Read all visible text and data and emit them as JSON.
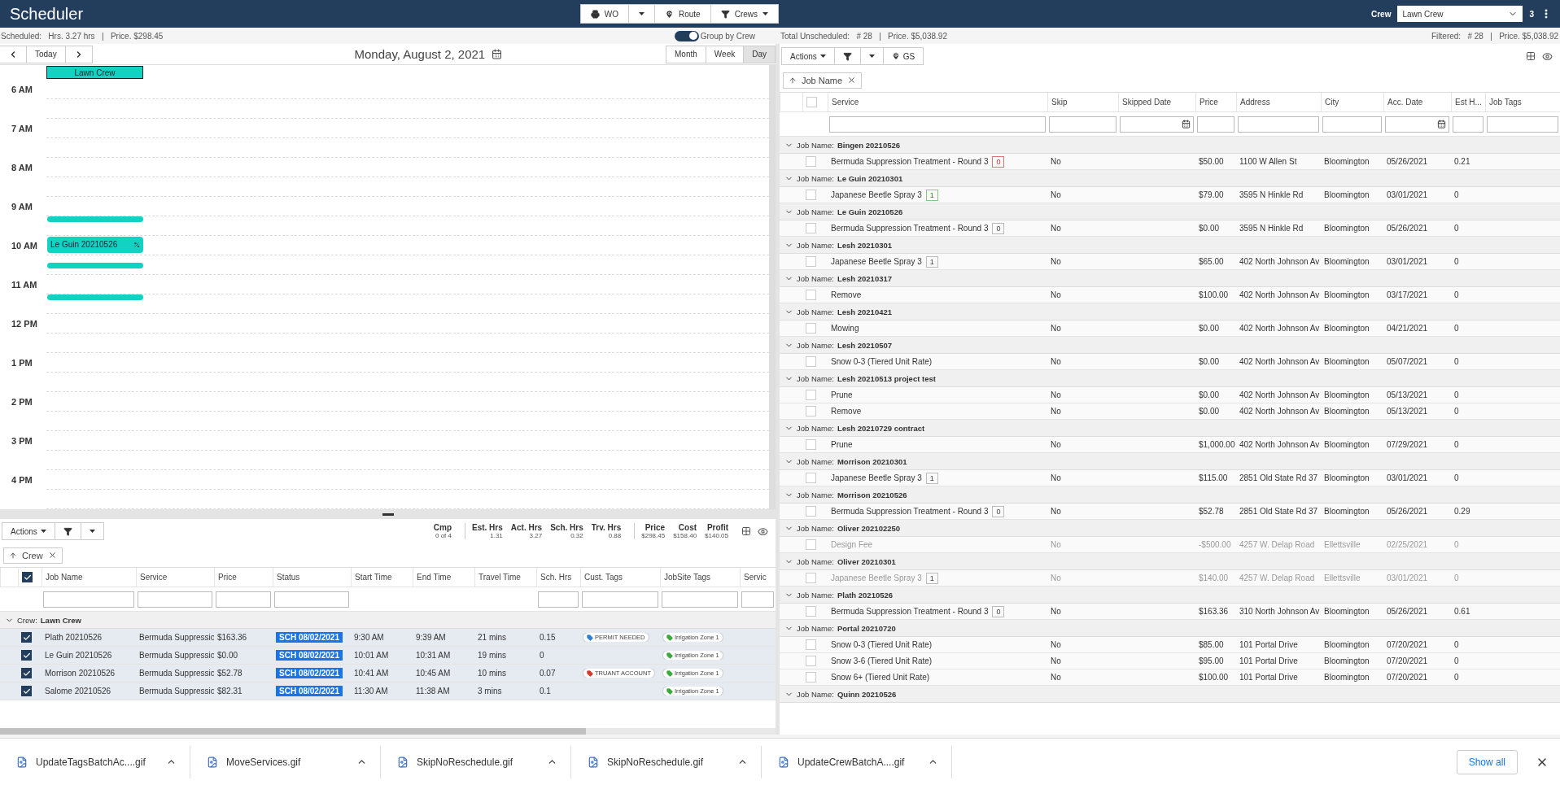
{
  "app": {
    "title": "Scheduler"
  },
  "toolbar": {
    "buttons": [
      {
        "kind": "print",
        "label": "WO"
      },
      {
        "kind": "menu"
      },
      {
        "kind": "route",
        "label": "Route"
      },
      {
        "kind": "crews",
        "label": "Crews"
      }
    ]
  },
  "crew_picker": {
    "label": "Crew",
    "value": "Lawn Crew",
    "count": "3"
  },
  "scheduled_summary": {
    "parts": [
      "Scheduled:",
      "Hrs. 3.27 hrs",
      "|",
      "Price. $298.45"
    ]
  },
  "group_toggle": {
    "label": "Group by Crew",
    "on": true
  },
  "unscheduled_summary": {
    "parts": [
      "Total Unscheduled:",
      "# 28",
      "|",
      "Price. $5,038.92"
    ]
  },
  "filtered_summary": {
    "parts": [
      "Filtered:",
      "# 28",
      "|",
      "Price. $5,038.92"
    ]
  },
  "calendar": {
    "today": "Today",
    "date": "Monday, August 2, 2021",
    "views": [
      {
        "label": "Month",
        "selected": false
      },
      {
        "label": "Week",
        "selected": false
      },
      {
        "label": "Day",
        "selected": true
      }
    ],
    "resource": "Lawn Crew",
    "hours": [
      "6 AM",
      "7 AM",
      "8 AM",
      "9 AM",
      "10 AM",
      "11 AM",
      "12 PM",
      "1 PM",
      "2 PM",
      "3 PM",
      "4 PM"
    ],
    "events": [
      {
        "kind": "bar"
      },
      {
        "kind": "titled",
        "title": "Le Guin 20210526"
      },
      {
        "kind": "bar"
      },
      {
        "kind": "bar"
      }
    ]
  },
  "crew_grid": {
    "actions": "Actions",
    "stat_groups": [
      {
        "items": [
          {
            "label": "Cmp",
            "value": "0 of 4"
          }
        ]
      },
      {
        "items": [
          {
            "label": "Est. Hrs",
            "value": "1.31"
          },
          {
            "label": "Act. Hrs",
            "value": "3.27"
          },
          {
            "label": "Sch. Hrs",
            "value": "0.32"
          },
          {
            "label": "Trv. Hrs",
            "value": "0.88"
          }
        ]
      },
      {
        "items": [
          {
            "label": "Price",
            "value": "$298.45"
          },
          {
            "label": "Cost",
            "value": "$158.40"
          },
          {
            "label": "Profit",
            "value": "$140.05"
          }
        ]
      }
    ],
    "group_chip": "Crew",
    "select_all": true,
    "columns": [
      {
        "label": "Job Name",
        "filter": true
      },
      {
        "label": "Service",
        "filter": true
      },
      {
        "label": "Price",
        "filter": true
      },
      {
        "label": "Status",
        "filter": true
      },
      {
        "label": "Start Time",
        "filter": false
      },
      {
        "label": "End Time",
        "filter": false
      },
      {
        "label": "Travel Time",
        "filter": false
      },
      {
        "label": "Sch. Hrs",
        "filter": true
      },
      {
        "label": "Cust. Tags",
        "filter": true
      },
      {
        "label": "JobSite Tags",
        "filter": true
      },
      {
        "label": "Servic",
        "filter": true
      }
    ],
    "group": {
      "label": "Crew:",
      "name": "Lawn Crew",
      "expanded": true
    },
    "rows": [
      {
        "checked": true,
        "job": "Plath 20210526",
        "service": "Bermuda Suppressio",
        "price": "$163.36",
        "status": "SCH 08/02/2021",
        "start": "9:30 AM",
        "end": "9:39 AM",
        "travel": "21 mins",
        "sch_hrs": "0.15",
        "cust_tags": [
          {
            "label": "PERMIT NEEDED",
            "color": "#2f80d1"
          }
        ],
        "site_tags": [
          {
            "label": "Irrigation Zone 1",
            "color": "#3bab3b"
          }
        ]
      },
      {
        "checked": true,
        "job": "Le Guin 20210526",
        "service": "Bermuda Suppressio",
        "price": "$0.00",
        "status": "SCH 08/02/2021",
        "start": "10:01 AM",
        "end": "10:31 AM",
        "travel": "19 mins",
        "sch_hrs": "0",
        "site_tags": [
          {
            "label": "Irrigation Zone 1",
            "color": "#3bab3b"
          }
        ]
      },
      {
        "checked": true,
        "job": "Morrison 20210526",
        "service": "Bermuda Suppressio",
        "price": "$52.78",
        "status": "SCH 08/02/2021",
        "start": "10:41 AM",
        "end": "10:45 AM",
        "travel": "10 mins",
        "sch_hrs": "0.07",
        "cust_tags": [
          {
            "label": "TRUANT ACCOUNT",
            "color": "#d23a2e"
          }
        ],
        "site_tags": [
          {
            "label": "Irrigation Zone 1",
            "color": "#3bab3b"
          }
        ]
      },
      {
        "checked": true,
        "job": "Salome 20210526",
        "service": "Bermuda Suppressio",
        "price": "$82.31",
        "status": "SCH 08/02/2021",
        "start": "11:30 AM",
        "end": "11:38 AM",
        "travel": "3 mins",
        "sch_hrs": "0.1",
        "site_tags": [
          {
            "label": "Irrigation Zone 1",
            "color": "#3bab3b"
          }
        ]
      }
    ]
  },
  "unscheduled_grid": {
    "actions": "Actions",
    "locate": "GS",
    "group_chip": "Job Name",
    "select_all": false,
    "columns": [
      {
        "label": "Service",
        "kind": "text"
      },
      {
        "label": "Skip",
        "kind": "text"
      },
      {
        "label": "Skipped Date",
        "kind": "date"
      },
      {
        "label": "Price",
        "kind": "text"
      },
      {
        "label": "Address",
        "kind": "text"
      },
      {
        "label": "City",
        "kind": "text"
      },
      {
        "label": "Acc. Date",
        "kind": "date"
      },
      {
        "label": "Est H...",
        "kind": "text"
      },
      {
        "label": "Job Tags",
        "kind": "text"
      }
    ],
    "groups": [
      {
        "label": "Job Name:",
        "name": "Bingen 20210526",
        "expanded": true,
        "rows": [
          {
            "checked": false,
            "dimmed": false,
            "service": "Bermuda Suppression Treatment - Round 3",
            "badge": {
              "value": "0",
              "kind": "alert"
            },
            "skip": "No",
            "price": "$50.00",
            "address": "1100 W Allen St",
            "city": "Bloomington",
            "acc_date": "05/26/2021",
            "est": "0.21"
          }
        ]
      },
      {
        "label": "Job Name:",
        "name": "Le Guin 20210301",
        "expanded": true,
        "rows": [
          {
            "checked": false,
            "dimmed": false,
            "service": "Japanese Beetle Spray 3",
            "badge": {
              "value": "1",
              "kind": "ok"
            },
            "skip": "No",
            "price": "$79.00",
            "address": "3595 N Hinkle Rd",
            "city": "Bloomington",
            "acc_date": "03/01/2021",
            "est": "0"
          }
        ]
      },
      {
        "label": "Job Name:",
        "name": "Le Guin 20210526",
        "expanded": true,
        "rows": [
          {
            "checked": false,
            "dimmed": false,
            "service": "Bermuda Suppression Treatment - Round 3",
            "badge": {
              "value": "0",
              "kind": "plain"
            },
            "skip": "No",
            "price": "$0.00",
            "address": "3595 N Hinkle Rd",
            "city": "Bloomington",
            "acc_date": "05/26/2021",
            "est": "0"
          }
        ]
      },
      {
        "label": "Job Name:",
        "name": "Lesh 20210301",
        "expanded": true,
        "rows": [
          {
            "checked": false,
            "dimmed": false,
            "service": "Japanese Beetle Spray 3",
            "badge": {
              "value": "1",
              "kind": "plain"
            },
            "skip": "No",
            "price": "$65.00",
            "address": "402 North Johnson Av",
            "city": "Bloomington",
            "acc_date": "03/01/2021",
            "est": "0"
          }
        ]
      },
      {
        "label": "Job Name:",
        "name": "Lesh 20210317",
        "expanded": true,
        "rows": [
          {
            "checked": false,
            "dimmed": false,
            "service": "Remove",
            "skip": "No",
            "price": "$100.00",
            "address": "402 North Johnson Av",
            "city": "Bloomington",
            "acc_date": "03/17/2021",
            "est": "0"
          }
        ]
      },
      {
        "label": "Job Name:",
        "name": "Lesh 20210421",
        "expanded": true,
        "rows": [
          {
            "checked": false,
            "dimmed": false,
            "service": "Mowing",
            "skip": "No",
            "price": "$0.00",
            "address": "402 North Johnson Av",
            "city": "Bloomington",
            "acc_date": "04/21/2021",
            "est": "0"
          }
        ]
      },
      {
        "label": "Job Name:",
        "name": "Lesh 20210507",
        "expanded": true,
        "rows": [
          {
            "checked": false,
            "dimmed": false,
            "service": "Snow 0-3 (Tiered Unit Rate)",
            "skip": "No",
            "price": "$0.00",
            "address": "402 North Johnson Av",
            "city": "Bloomington",
            "acc_date": "05/07/2021",
            "est": "0"
          }
        ]
      },
      {
        "label": "Job Name:",
        "name": "Lesh 20210513 project test",
        "expanded": true,
        "rows": [
          {
            "checked": false,
            "dimmed": false,
            "service": "Prune",
            "skip": "No",
            "price": "$0.00",
            "address": "402 North Johnson Av",
            "city": "Bloomington",
            "acc_date": "05/13/2021",
            "est": "0"
          },
          {
            "checked": false,
            "dimmed": false,
            "service": "Remove",
            "skip": "No",
            "price": "$0.00",
            "address": "402 North Johnson Av",
            "city": "Bloomington",
            "acc_date": "05/13/2021",
            "est": "0"
          }
        ]
      },
      {
        "label": "Job Name:",
        "name": "Lesh 20210729 contract",
        "expanded": true,
        "rows": [
          {
            "checked": false,
            "dimmed": false,
            "service": "Prune",
            "skip": "No",
            "price": "$1,000.00",
            "address": "402 North Johnson Av",
            "city": "Bloomington",
            "acc_date": "07/29/2021",
            "est": "0"
          }
        ]
      },
      {
        "label": "Job Name:",
        "name": "Morrison 20210301",
        "expanded": true,
        "rows": [
          {
            "checked": false,
            "dimmed": false,
            "service": "Japanese Beetle Spray 3",
            "badge": {
              "value": "1",
              "kind": "plain"
            },
            "skip": "No",
            "price": "$115.00",
            "address": "2851 Old State Rd 37",
            "city": "Bloomington",
            "acc_date": "03/01/2021",
            "est": "0"
          }
        ]
      },
      {
        "label": "Job Name:",
        "name": "Morrison 20210526",
        "expanded": true,
        "rows": [
          {
            "checked": false,
            "dimmed": false,
            "service": "Bermuda Suppression Treatment - Round 3",
            "badge": {
              "value": "0",
              "kind": "plain"
            },
            "skip": "No",
            "price": "$52.78",
            "address": "2851 Old State Rd 37",
            "city": "Bloomington",
            "acc_date": "05/26/2021",
            "est": "0.29"
          }
        ]
      },
      {
        "label": "Job Name:",
        "name": "Oliver 202102250",
        "expanded": true,
        "rows": [
          {
            "checked": false,
            "dimmed": true,
            "service": "Design Fee",
            "skip": "No",
            "price": "-$500.00",
            "address": "4257 W. Delap Road",
            "city": "Ellettsville",
            "acc_date": "02/25/2021",
            "est": "0"
          }
        ]
      },
      {
        "label": "Job Name:",
        "name": "Oliver 20210301",
        "expanded": true,
        "rows": [
          {
            "checked": false,
            "dimmed": true,
            "service": "Japanese Beetle Spray 3",
            "badge": {
              "value": "1",
              "kind": "plain"
            },
            "skip": "No",
            "price": "$140.00",
            "address": "4257 W. Delap Road",
            "city": "Ellettsville",
            "acc_date": "03/01/2021",
            "est": "0"
          }
        ]
      },
      {
        "label": "Job Name:",
        "name": "Plath 20210526",
        "expanded": true,
        "rows": [
          {
            "checked": false,
            "dimmed": false,
            "service": "Bermuda Suppression Treatment - Round 3",
            "badge": {
              "value": "0",
              "kind": "plain"
            },
            "skip": "No",
            "price": "$163.36",
            "address": "310 North Johnson Av",
            "city": "Bloomington",
            "acc_date": "05/26/2021",
            "est": "0.61"
          }
        ]
      },
      {
        "label": "Job Name:",
        "name": "Portal 20210720",
        "expanded": true,
        "rows": [
          {
            "checked": false,
            "dimmed": false,
            "service": "Snow 0-3 (Tiered Unit Rate)",
            "skip": "No",
            "price": "$85.00",
            "address": "101 Portal Drive",
            "city": "Bloomington",
            "acc_date": "07/20/2021",
            "est": "0"
          },
          {
            "checked": false,
            "dimmed": false,
            "service": "Snow 3-6 (Tiered Unit Rate)",
            "skip": "No",
            "price": "$95.00",
            "address": "101 Portal Drive",
            "city": "Bloomington",
            "acc_date": "07/20/2021",
            "est": "0"
          },
          {
            "checked": false,
            "dimmed": false,
            "service": "Snow 6+ (Tiered Unit Rate)",
            "skip": "No",
            "price": "$100.00",
            "address": "101 Portal Drive",
            "city": "Bloomington",
            "acc_date": "07/20/2021",
            "est": "0"
          }
        ]
      },
      {
        "label": "Job Name:",
        "name": "Quinn 20210526",
        "expanded": true
      }
    ]
  },
  "downloads": {
    "items": [
      {
        "name": "UpdateTagsBatchAc....gif"
      },
      {
        "name": "MoveServices.gif"
      },
      {
        "name": "SkipNoReschedule.gif"
      },
      {
        "name": "SkipNoReschedule.gif"
      },
      {
        "name": "UpdateCrewBatchA....gif"
      }
    ],
    "show_all": "Show all"
  }
}
